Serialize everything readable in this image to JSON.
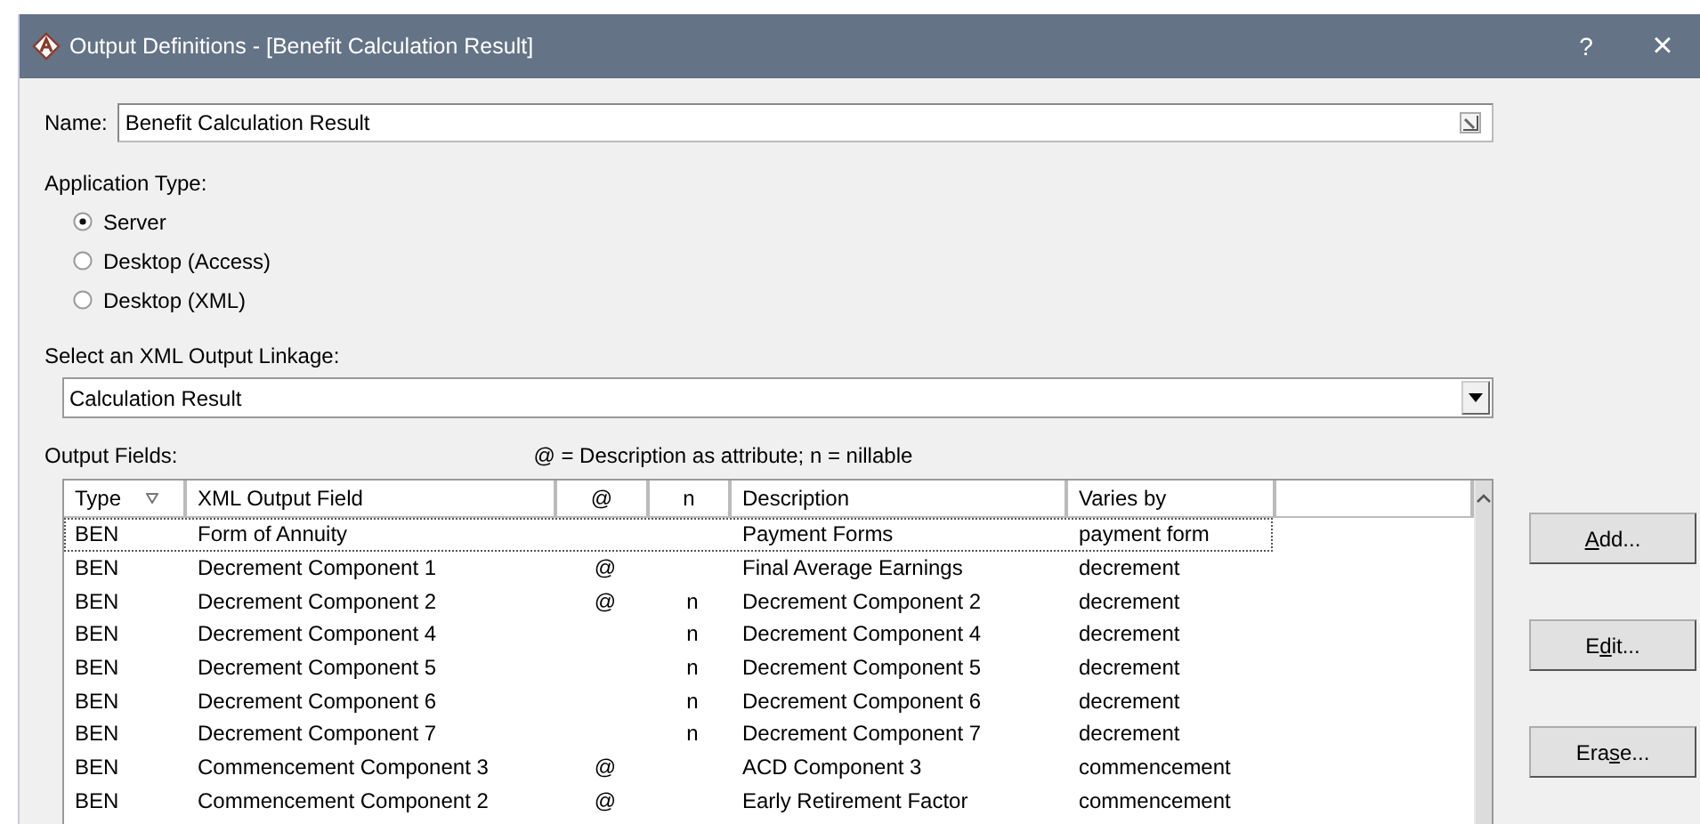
{
  "window": {
    "title": "Output Definitions - [Benefit Calculation Result]",
    "help": "?",
    "close": "×"
  },
  "name_field": {
    "label": "Name:",
    "value": "Benefit Calculation Result"
  },
  "application_type": {
    "label": "Application Type:",
    "options": [
      {
        "label": "Server",
        "selected": true
      },
      {
        "label": "Desktop (Access)",
        "selected": false
      },
      {
        "label": "Desktop (XML)",
        "selected": false
      }
    ]
  },
  "linkage": {
    "label": "Select an XML Output Linkage:",
    "value": "Calculation Result"
  },
  "output_fields": {
    "label": "Output Fields:",
    "legend": "@ = Description as attribute; n = nillable",
    "columns": [
      "Type",
      "XML Output Field",
      "@",
      "n",
      "Description",
      "Varies by"
    ],
    "rows": [
      {
        "cells": [
          "BEN",
          "Form of Annuity",
          "",
          "",
          "Payment Forms",
          "payment form"
        ],
        "focused": true
      },
      {
        "cells": [
          "BEN",
          "Decrement Component 1",
          "@",
          "",
          "Final Average Earnings",
          "decrement"
        ],
        "focused": false
      },
      {
        "cells": [
          "BEN",
          "Decrement Component 2",
          "@",
          "n",
          "Decrement Component 2",
          "decrement"
        ],
        "focused": false
      },
      {
        "cells": [
          "BEN",
          "Decrement Component 4",
          "",
          "n",
          "Decrement Component 4",
          "decrement"
        ],
        "focused": false
      },
      {
        "cells": [
          "BEN",
          "Decrement Component 5",
          "",
          "n",
          "Decrement Component 5",
          "decrement"
        ],
        "focused": false
      },
      {
        "cells": [
          "BEN",
          "Decrement Component 6",
          "",
          "n",
          "Decrement Component 6",
          "decrement"
        ],
        "focused": false
      },
      {
        "cells": [
          "BEN",
          "Decrement Component 7",
          "",
          "n",
          "Decrement Component 7",
          "decrement"
        ],
        "focused": false
      },
      {
        "cells": [
          "BEN",
          "Commencement Component 3",
          "@",
          "",
          "ACD Component 3",
          "commencement"
        ],
        "focused": false
      },
      {
        "cells": [
          "BEN",
          "Commencement Component 2",
          "@",
          "",
          "Early Retirement Factor",
          "commencement"
        ],
        "focused": false
      }
    ]
  },
  "buttons": [
    {
      "mnemonic": "A",
      "after": "dd..."
    },
    {
      "before": "E",
      "mnemonic": "d",
      "after": "it..."
    },
    {
      "before": "Era",
      "mnemonic": "s",
      "after": "e..."
    }
  ]
}
